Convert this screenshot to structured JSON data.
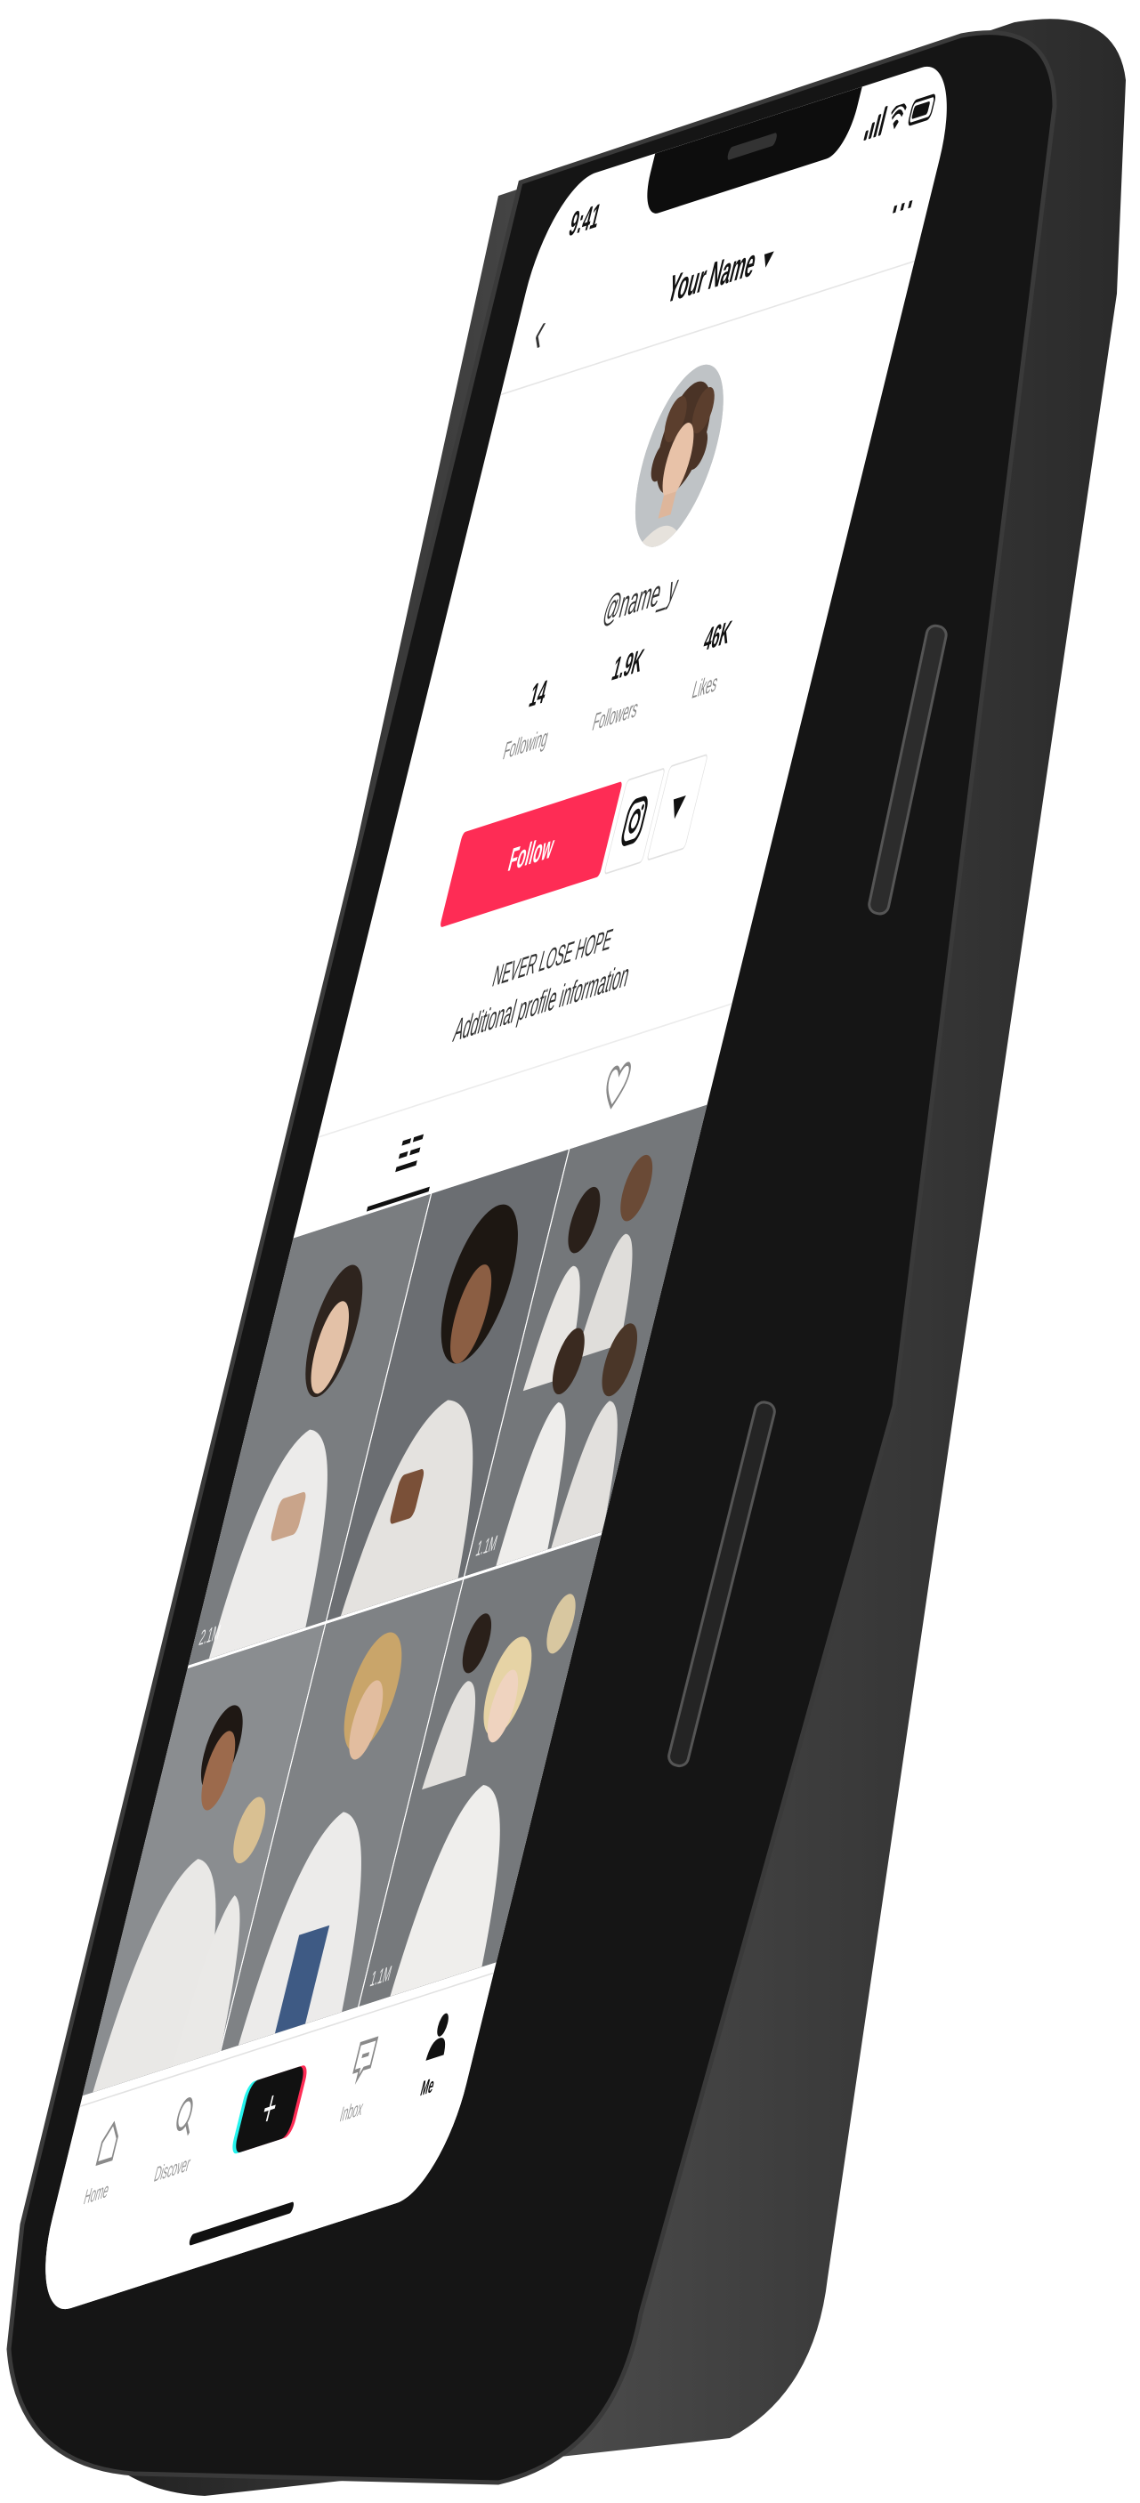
{
  "status_bar": {
    "time": "9:41"
  },
  "nav": {
    "title": "Your Name"
  },
  "profile": {
    "username": "@name_y",
    "stats": [
      {
        "value": "14",
        "label": "Following"
      },
      {
        "value": "1.9K",
        "label": "Followers"
      },
      {
        "value": "46K",
        "label": "Likes"
      }
    ],
    "follow_label": "Follow",
    "bio_line1": "NEVER LOSE HOPE",
    "bio_line2": "Additional profile information"
  },
  "tabs": [
    {
      "icon": "grid-list-icon",
      "active": true
    },
    {
      "icon": "heart-outline-icon",
      "active": false
    }
  ],
  "video_grid": [
    {
      "views": "2.1M"
    },
    {
      "views": ""
    },
    {
      "views": "1.1M"
    },
    {
      "views": ""
    },
    {
      "views": ""
    },
    {
      "views": "1.1M"
    }
  ],
  "bottom_nav": {
    "items": [
      {
        "label": "Home"
      },
      {
        "label": "Discover"
      },
      {
        "label": "Inbox"
      },
      {
        "label": "Me"
      }
    ]
  },
  "colors": {
    "follow": "#fe2c55",
    "accent_cyan": "#25f4ee",
    "phone_frame": "#222222",
    "text_muted": "#8a8a8a"
  }
}
